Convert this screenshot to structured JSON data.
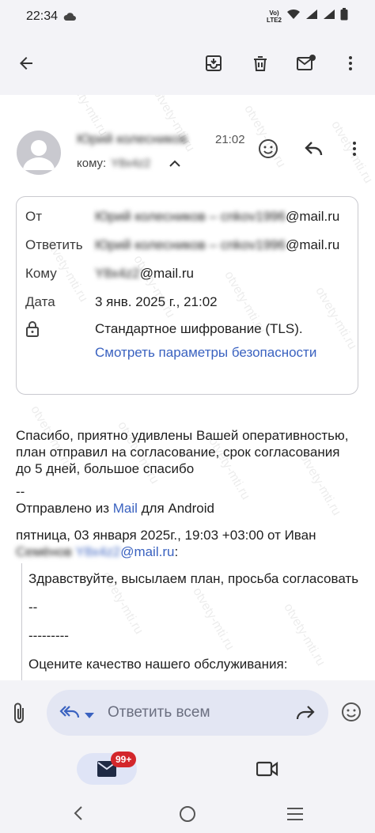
{
  "status_bar": {
    "time": "22:34",
    "network_label_top": "Vo)",
    "network_label_mid": "LTE2",
    "battery_label": "battery"
  },
  "toolbar": {
    "back": "arrow-back-icon",
    "archive": "archive-icon",
    "delete": "delete-icon",
    "mark_unread": "mark-unread-icon",
    "more": "more-vert-icon"
  },
  "message": {
    "sender_name": "Юрий колесников",
    "time": "21:02",
    "to_label": "кому:",
    "to_value": "Y8x4z2"
  },
  "details": {
    "from_label": "От",
    "from_hidden": "Юрий колесников – cnkov1996",
    "from_domain": "@mail.ru",
    "reply_label": "Ответить",
    "reply_hidden": "Юрий колесников – cnkov1996",
    "reply_domain": "@mail.ru",
    "to_label": "Кому",
    "to_hidden": "Y8x4z2",
    "to_domain": "@mail.ru",
    "date_label": "Дата",
    "date_value": "3 янв. 2025 г., 21:02",
    "encryption": "Стандартное шифрование (TLS).",
    "security_link": "Смотреть параметры безопасности"
  },
  "body": {
    "paragraph": "Спасибо, приятно удивлены Вашей оперативностью, план отправил на согласование, срок согласования до 5 дней, большое спасибо",
    "separator": "--",
    "sent_from_prefix": "Отправлено из ",
    "sent_from_link": "Mail",
    "sent_from_suffix": " для Android",
    "quote_header_line1": "пятница, 03 января 2025г., 19:03 +03:00 от Иван",
    "quote_header_hidden_name": "Семёнов",
    "quote_header_hidden_email": "Y8x4z2",
    "quote_header_domain": "@mail.ru",
    "quote_header_colon": ":"
  },
  "quote": {
    "greeting": "Здравствуйте, высылаем план, просьба согласовать",
    "separator1": "--",
    "separator2": "---------",
    "rating": "Оцените качество нашего обслуживания:"
  },
  "reply_bar": {
    "placeholder": "Ответить всем"
  },
  "bottom_nav": {
    "badge": "99+"
  },
  "watermark": "otvety-mti.ru"
}
